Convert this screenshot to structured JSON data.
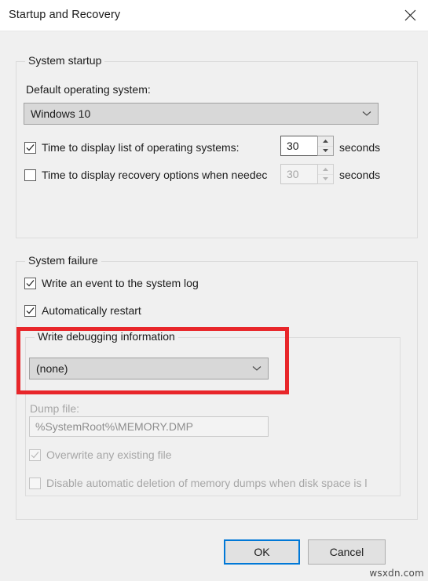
{
  "window": {
    "title": "Startup and Recovery",
    "close_icon": "close-icon"
  },
  "system_startup": {
    "group_label": "System startup",
    "default_os_label": "Default operating system:",
    "default_os_value": "Windows 10",
    "default_os_arrow_icon": "chevron-down-icon",
    "boot_timeout": {
      "label": "Time to display list of operating systems:",
      "checked": "true",
      "value": "30",
      "unit": "seconds",
      "unit_clipped": "seconds"
    },
    "recovery_timeout": {
      "label": "Time to display recovery options when needed",
      "label_clipped": "Time to display recovery options when needec",
      "checked": "false",
      "value": "30",
      "unit": "seconds",
      "unit_clipped": "seconds"
    }
  },
  "system_failure": {
    "group_label": "System failure",
    "write_event_label": "Write an event to the system log",
    "write_event_checked": "true",
    "auto_restart_label": "Automatically restart",
    "auto_restart_checked": "true",
    "debug_group_label": "Write debugging information",
    "debug_value": "(none)",
    "debug_arrow_icon": "chevron-down-icon",
    "dump_file_label": "Dump file:",
    "dump_file_value": "%SystemRoot%\\MEMORY.DMP",
    "overwrite_label": "Overwrite any existing file",
    "overwrite_checked": "true",
    "disable_deletion_label": "Disable automatic deletion of memory dumps when disk space is low",
    "disable_deletion_label_clipped": "Disable automatic deletion of memory dumps when disk space is l",
    "disable_deletion_checked": "false"
  },
  "footer": {
    "ok_label": "OK",
    "cancel_label": "Cancel"
  },
  "annotation": {
    "color": "#e8262a",
    "target": "write-debugging-information-dropdown"
  },
  "watermark": {
    "text": "wsxdn.com"
  }
}
